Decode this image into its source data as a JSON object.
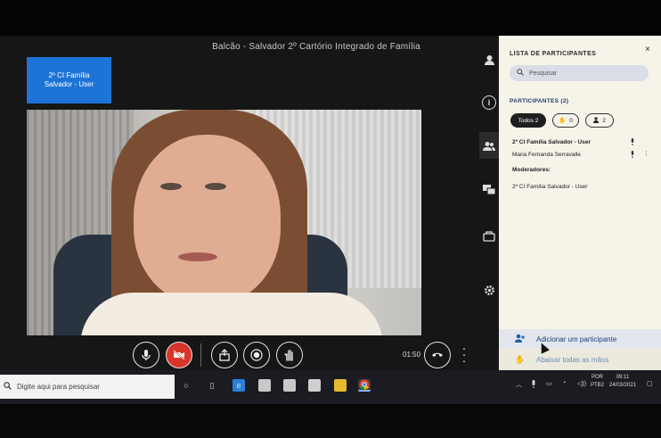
{
  "meeting": {
    "title": "Balcão - Salvador 2º Cartório Integrado de Família",
    "local_user_tile": "2º CI Família Salvador - User",
    "timer": "01:50"
  },
  "controls": {
    "mic": "microphone-icon",
    "camera": "camera-off-icon",
    "share": "share-screen-icon",
    "record": "record-icon",
    "raise_hand": "raise-hand-icon",
    "leave": "leave-call-icon"
  },
  "panel": {
    "title": "LISTA DE PARTICIPANTES",
    "close": "×",
    "search_placeholder": "Pesquisar",
    "participants_label": "PARTICIPANTES (2)",
    "chips": {
      "all": "Todos 2",
      "hands_count": "0",
      "users_count": "2"
    },
    "participants": [
      {
        "name": "2º CI Família Salvador - User",
        "bold": true
      },
      {
        "name": "Maria Fernanda Serravalle",
        "bold": false
      }
    ],
    "moderators_label": "Moderadores:",
    "moderators": [
      "2º CI Família Salvador - User"
    ],
    "footer": {
      "add_participant": "Adicionar um participante",
      "lower_hands": "Abaixar todas as mãos"
    }
  },
  "taskbar": {
    "search_placeholder": "Digite aqui para pesquisar",
    "lang_top": "POR",
    "lang_bottom": "PTB2",
    "time": "09:11",
    "date": "24/03/2021"
  },
  "colors": {
    "tile_blue": "#1e74d6",
    "camera_off_red": "#d8342a",
    "panel_bg": "#f6f3e9"
  }
}
